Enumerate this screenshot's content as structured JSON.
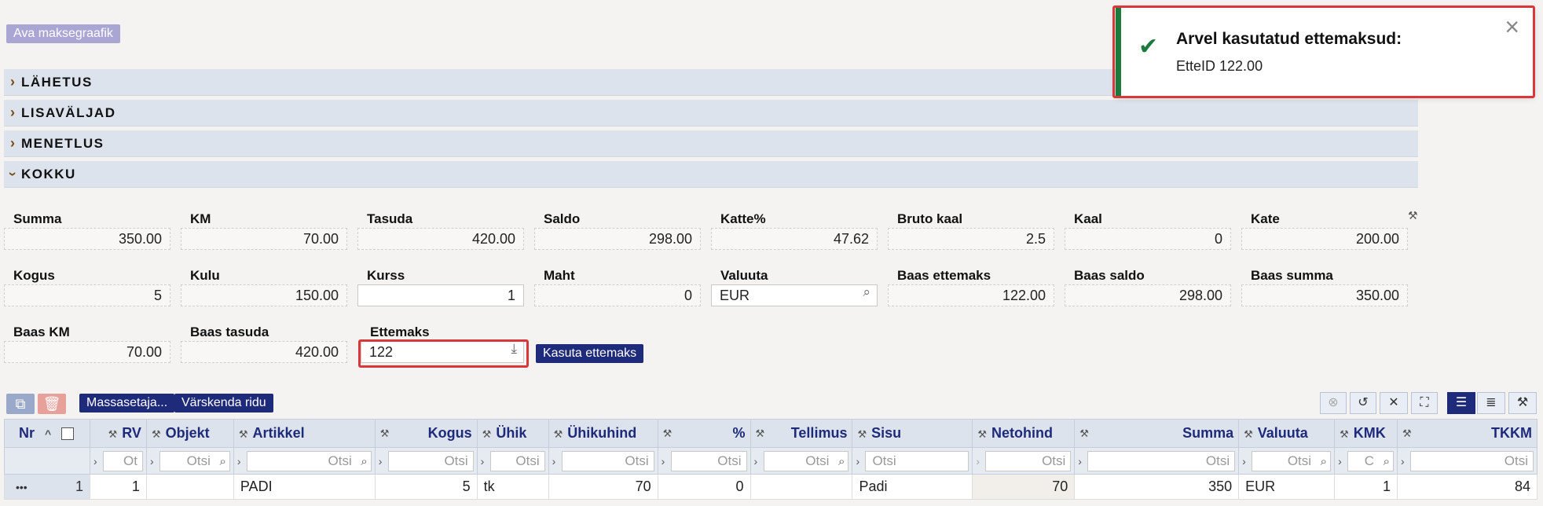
{
  "top": {
    "schedule_button": "Ava maksegraafik"
  },
  "sections": [
    "LÄHETUS",
    "LISAVÄLJAD",
    "MENETLUS",
    "KOKKU"
  ],
  "summary": {
    "row1": [
      {
        "label": "Summa",
        "value": "350.00"
      },
      {
        "label": "KM",
        "value": "70.00"
      },
      {
        "label": "Tasuda",
        "value": "420.00"
      },
      {
        "label": "Saldo",
        "value": "298.00"
      },
      {
        "label": "Katte%",
        "value": "47.62"
      },
      {
        "label": "Bruto kaal",
        "value": "2.5"
      },
      {
        "label": "Kaal",
        "value": "0"
      },
      {
        "label": "Kate",
        "value": "200.00"
      }
    ],
    "row2": [
      {
        "label": "Kogus",
        "value": "5"
      },
      {
        "label": "Kulu",
        "value": "150.00"
      },
      {
        "label": "Kurss",
        "value": "1"
      },
      {
        "label": "Maht",
        "value": "0"
      },
      {
        "label": "Valuuta",
        "value": "EUR"
      },
      {
        "label": "Baas ettemaks",
        "value": "122.00"
      },
      {
        "label": "Baas saldo",
        "value": "298.00"
      },
      {
        "label": "Baas summa",
        "value": "350.00"
      }
    ],
    "row3": [
      {
        "label": "Baas KM",
        "value": "70.00"
      },
      {
        "label": "Baas tasuda",
        "value": "420.00"
      },
      {
        "label": "Ettemaks",
        "value": "122"
      }
    ],
    "use_prepayment_button": "Kasuta ettemaks"
  },
  "toast": {
    "title": "Arvel kasutatud ettemaksud:",
    "message": "EtteID 122.00"
  },
  "toolbar": {
    "mass_button": "Massasetaja...",
    "refresh_button": "Värskenda ridu"
  },
  "grid": {
    "columns": [
      "Nr",
      "RV",
      "Objekt",
      "Artikkel",
      "Kogus",
      "Ühik",
      "Ühikuhind",
      "%",
      "Tellimus",
      "Sisu",
      "Netohind",
      "Summa",
      "Valuuta",
      "KMK",
      "TKKM"
    ],
    "filter_placeholder": "Otsi",
    "filter_short_placeholders": {
      "RV": "Ot",
      "KMK": "C"
    },
    "row": {
      "menu": "•••",
      "nr": "1",
      "rv": "1",
      "objekt": "",
      "artikkel": "PADI",
      "kogus": "5",
      "yhik": "tk",
      "yhikuhind": "70",
      "protsent": "0",
      "tellimus": "",
      "sisu": "Padi",
      "netohind": "70",
      "summa": "350",
      "valuuta": "EUR",
      "kmk": "1",
      "tkkm": "84"
    }
  }
}
